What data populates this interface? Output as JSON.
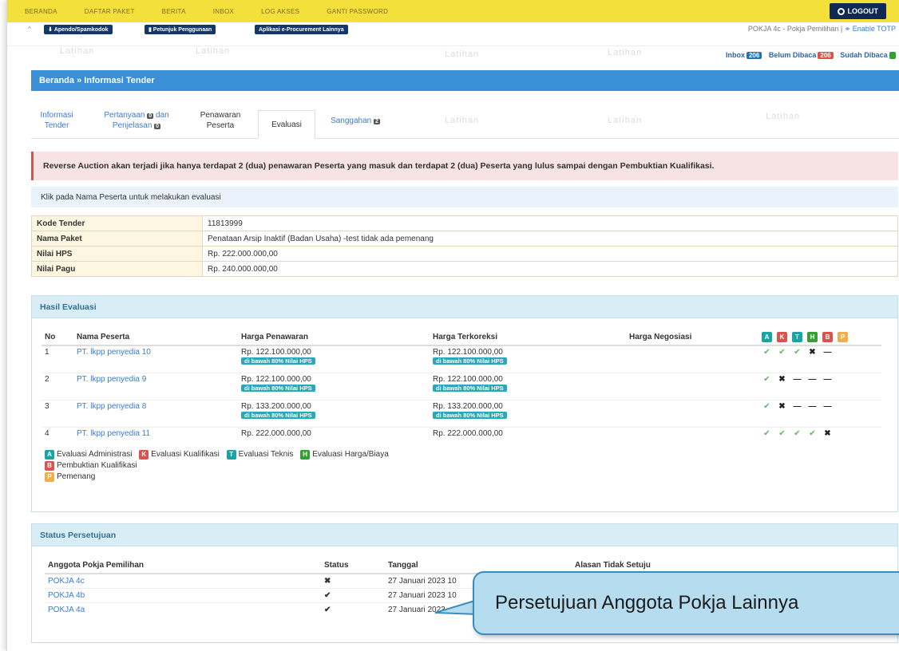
{
  "topnav": {
    "items": [
      "BERANDA",
      "DAFTAR PAKET",
      "BERITA",
      "INBOX",
      "LOG AKSES",
      "GANTI PASSWORD"
    ],
    "logout": "LOGOUT"
  },
  "subbar": {
    "btn1": "Apendo/Spamkodok",
    "btn2": "Petunjuk Penggunaan",
    "btn3": "Aplikasi e-Procurement Lainnya",
    "pokja": "POKJA 4c - Pokja Pemilihan |",
    "totp": "Enable TOTP",
    "inbox_label": "Inbox",
    "inbox_count": "206",
    "unread_label": "Belum Dibaca",
    "unread_count": "206",
    "read_label": "Sudah Dibaca"
  },
  "watermark": "Latihan",
  "breadcrumb": "Beranda » Informasi Tender",
  "tabs": {
    "t1a": "Informasi",
    "t1b": "Tender",
    "t2a": "Pertanyaan",
    "t2cnt": "0",
    "t2b": "dan",
    "t2c": "Penjelasan",
    "t2cnt2": "0",
    "t3a": "Penawaran",
    "t3b": "Peserta",
    "t4": "Evaluasi",
    "t5": "Sanggahan",
    "t5cnt": "2"
  },
  "alert_red": "Reverse Auction akan terjadi jika hanya terdapat 2 (dua) penawaran Peserta yang masuk dan terdapat 2 (dua) Peserta yang lulus sampai dengan Pembuktian Kualifikasi.",
  "alert_blue": "Klik pada Nama Peserta untuk melakukan evaluasi",
  "info": {
    "kode_label": "Kode Tender",
    "kode": "11813999",
    "nama_label": "Nama Paket",
    "nama": "Penataan Arsip Inaktif (Badan Usaha) -test tidak ada pemenang",
    "hps_label": "Nilai HPS",
    "hps": "Rp. 222.000.000,00",
    "pagu_label": "Nilai Pagu",
    "pagu": "Rp. 240.000.000,00"
  },
  "hasil": {
    "title": "Hasil Evaluasi",
    "headers": {
      "no": "No",
      "nama": "Nama Peserta",
      "penawaran": "Harga Penawaran",
      "terkoreksi": "Harga Terkoreksi",
      "negosiasi": "Harga Negosiasi"
    },
    "flags": [
      "A",
      "K",
      "T",
      "H",
      "B",
      "P"
    ],
    "badge": "di bawah 80% Nilai HPS",
    "rows": [
      {
        "no": "1",
        "nama": "PT. lkpp penyedia 10",
        "penawaran": "Rp. 122.100.000,00",
        "terkoreksi": "Rp. 122.100.000,00"
      },
      {
        "no": "2",
        "nama": "PT. lkpp penyedia 9",
        "penawaran": "Rp. 122.100.000,00",
        "terkoreksi": "Rp. 122.100.000,00"
      },
      {
        "no": "3",
        "nama": "PT. lkpp penyedia 8",
        "penawaran": "Rp. 133.200.000,00",
        "terkoreksi": "Rp. 133.200.000,00"
      },
      {
        "no": "4",
        "nama": "PT. lkpp penyedia 11",
        "penawaran": "Rp. 222.000.000,00",
        "terkoreksi": "Rp. 222.000.000,00"
      }
    ],
    "legend": {
      "A": "Evaluasi Administrasi",
      "K": "Evaluasi Kualifikasi",
      "T": "Evaluasi Teknis",
      "H": "Evaluasi Harga/Biaya",
      "B": "Pembuktian Kualifikasi",
      "P": "Pemenang"
    }
  },
  "persetujuan": {
    "title": "Status Persetujuan",
    "headers": {
      "anggota": "Anggota Pokja Pemilihan",
      "status": "Status",
      "tanggal": "Tanggal",
      "alasan": "Alasan Tidak Setuju"
    },
    "rows": [
      {
        "anggota": "POKJA 4c",
        "tanggal": "27 Januari 2023 10"
      },
      {
        "anggota": "POKJA 4b",
        "tanggal": "27 Januari 2023 10"
      },
      {
        "anggota": "POKJA 4a",
        "tanggal": "27 Januari 2023"
      }
    ]
  },
  "callout": "Persetujuan Anggota Pokja Lainnya"
}
